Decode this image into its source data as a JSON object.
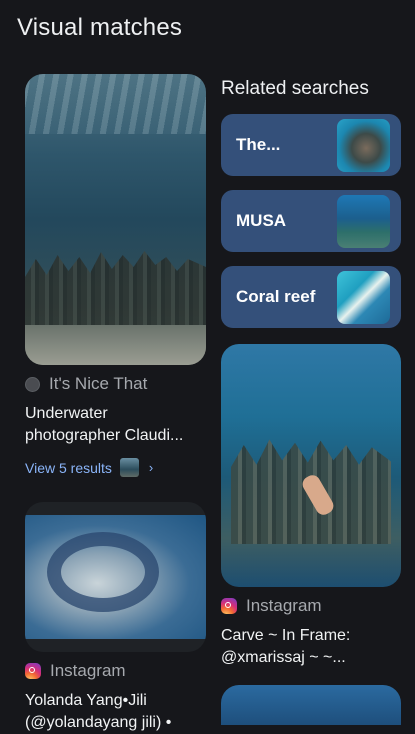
{
  "header": {
    "title": "Visual matches"
  },
  "left_column": {
    "card1": {
      "source": "It's Nice That",
      "caption_lines": [
        "Underwater",
        "photographer Claudi..."
      ],
      "view_results": "View 5 results"
    },
    "card2": {
      "source": "Instagram",
      "caption_lines": [
        "Yolanda Yang•Jili",
        "(@yolandayang jili) •"
      ]
    }
  },
  "related": {
    "title": "Related searches",
    "items": [
      {
        "label": "The..."
      },
      {
        "label": "MUSA"
      },
      {
        "label": "Coral reef"
      }
    ]
  },
  "right_card": {
    "source": "Instagram",
    "caption_lines": [
      "Carve ~ In Frame:",
      "@xmarissaj ~ ~..."
    ]
  }
}
